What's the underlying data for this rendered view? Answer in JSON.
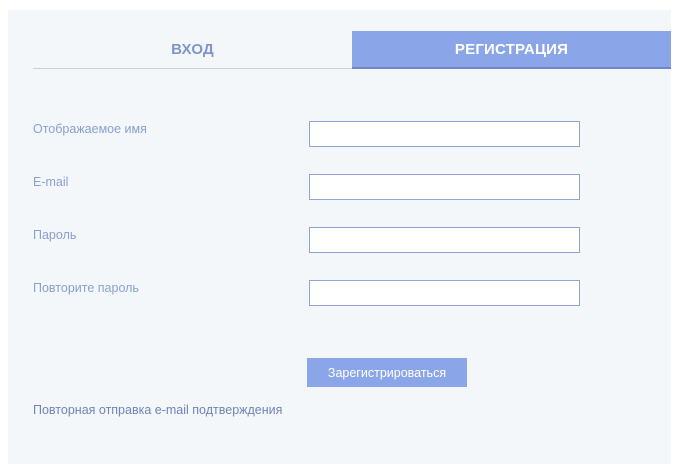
{
  "tabs": {
    "login": "ВХОД",
    "register": "РЕГИСТРАЦИЯ"
  },
  "form": {
    "display_name_label": "Отображаемое имя",
    "display_name_value": "",
    "email_label": "E-mail",
    "email_value": "",
    "password_label": "Пароль",
    "password_value": "",
    "repeat_password_label": "Повторите пароль",
    "repeat_password_value": "",
    "submit_label": "Зарегистрироваться"
  },
  "resend_link": "Повторная отправка e-mail подтверждения",
  "colors": {
    "accent": "#8aa5e8",
    "label_text": "#8aa0cf",
    "panel_bg": "#f4f7f9"
  }
}
